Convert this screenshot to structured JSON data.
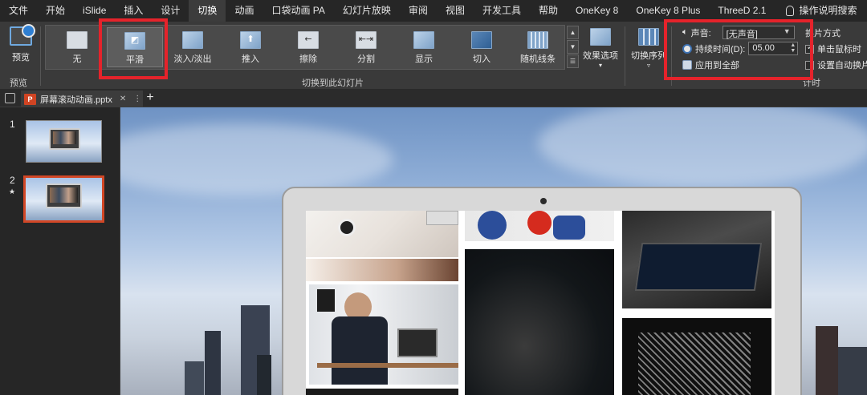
{
  "menu": {
    "items": [
      "文件",
      "开始",
      "iSlide",
      "插入",
      "设计",
      "切换",
      "动画",
      "口袋动画 PA",
      "幻灯片放映",
      "审阅",
      "视图",
      "开发工具",
      "帮助",
      "OneKey 8",
      "OneKey 8 Plus",
      "ThreeD 2.1"
    ],
    "active_index": 5,
    "search_label": "操作说明搜索"
  },
  "ribbon": {
    "preview_label": "预览",
    "preview_group": "预览",
    "transitions_group": "切换到此幻灯片",
    "transitions": [
      {
        "label": "无",
        "selected": false
      },
      {
        "label": "平滑",
        "selected": true
      },
      {
        "label": "淡入/淡出",
        "selected": false
      },
      {
        "label": "推入",
        "selected": false
      },
      {
        "label": "擦除",
        "selected": false
      },
      {
        "label": "分割",
        "selected": false
      },
      {
        "label": "显示",
        "selected": false
      },
      {
        "label": "切入",
        "selected": false
      },
      {
        "label": "随机线条",
        "selected": false
      }
    ],
    "effect_options": "效果选项",
    "switch_sequence": "切换序列",
    "timing": {
      "sound_label": "声音:",
      "sound_value": "[无声音]",
      "duration_label": "持续时间(D):",
      "duration_value": "05.00",
      "apply_all": "应用到全部",
      "advance_label": "换片方式",
      "on_click": "单击鼠标时",
      "auto_after": "设置自动换片",
      "group_label": "计时"
    }
  },
  "tabs": {
    "doc_name": "屏幕滚动动画.pptx",
    "badge": "P"
  },
  "slides": [
    {
      "number": "1",
      "star": ""
    },
    {
      "number": "2",
      "star": "★"
    }
  ],
  "colors": {
    "accent_red": "#e5232b",
    "selected_thumb": "#d24726",
    "ribbon_bg": "#3a3a3a"
  }
}
